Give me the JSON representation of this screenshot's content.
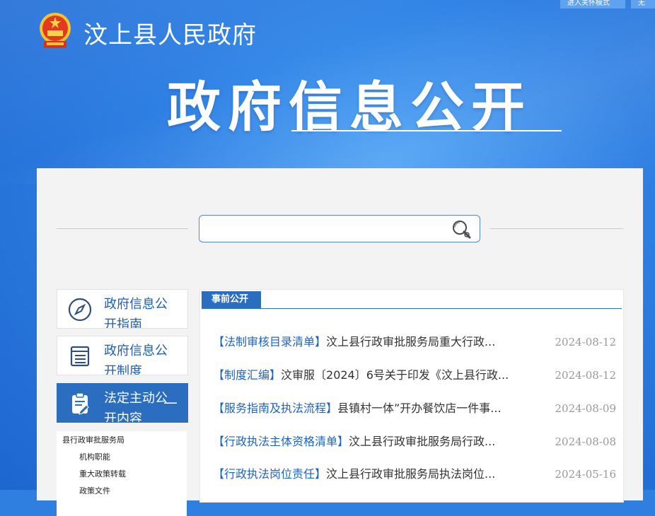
{
  "header": {
    "top_links": [
      "进入关怀模式",
      "无"
    ],
    "site_name": "汶上县人民政府",
    "title": "政府信息公开"
  },
  "search": {
    "placeholder": "",
    "value": ""
  },
  "sidebar": {
    "cards": [
      {
        "label": "政府信息公开指南",
        "icon": "compass-icon"
      },
      {
        "label": "政府信息公开制度",
        "icon": "document-list-icon"
      },
      {
        "label": "法定主动公开内容",
        "icon": "clipboard-edit-icon",
        "active": true,
        "toggle": "—"
      }
    ],
    "sub_items": [
      "县行政审批服务局",
      "机构职能",
      "重大政策转载",
      "政策文件"
    ]
  },
  "news": {
    "tab": "事前公开",
    "items": [
      {
        "category": "【法制审核目录清单】",
        "title": "汶上县行政审批服务局重大行政...",
        "date": "2024-08-12"
      },
      {
        "category": "【制度汇编】",
        "title": "汶审服〔2024〕6号关于印发《汶上县行政...",
        "date": "2024-08-12"
      },
      {
        "category": "【服务指南及执法流程】",
        "title": "县镇村一体”开办餐饮店一件事...",
        "date": "2024-08-09"
      },
      {
        "category": "【行政执法主体资格清单】",
        "title": "汶上县行政审批服务局行政...",
        "date": "2024-08-08"
      },
      {
        "category": "【行政执法岗位责任】",
        "title": "汶上县行政审批服务局执法岗位...",
        "date": "2024-05-16"
      }
    ]
  },
  "colors": {
    "accent": "#2b6ec0",
    "link": "#1f63c0",
    "hero": "#2e7fe3"
  }
}
